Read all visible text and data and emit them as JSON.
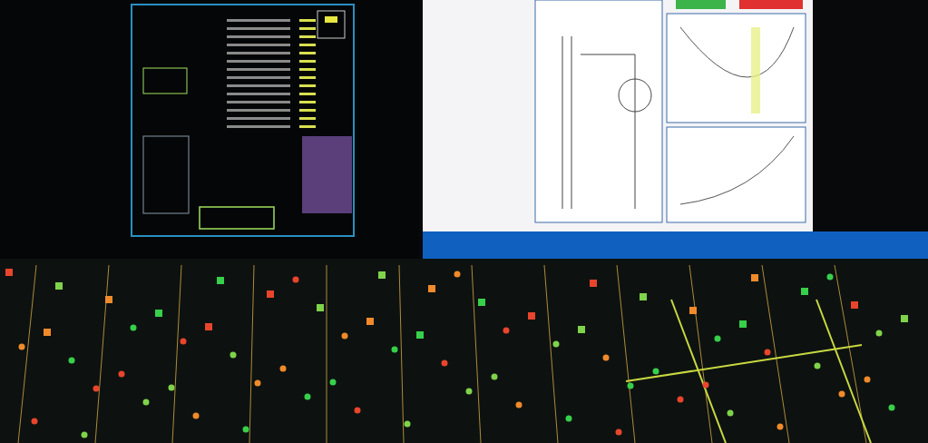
{
  "photo": {
    "kind": "control-room-monitors"
  }
}
